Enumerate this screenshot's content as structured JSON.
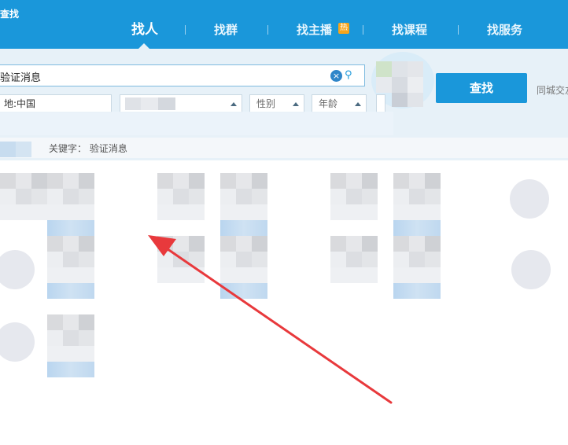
{
  "window": {
    "title": "查找"
  },
  "nav": {
    "tabs": [
      {
        "label": "找人"
      },
      {
        "label": "找群"
      },
      {
        "label": "找主播"
      },
      {
        "label": "找课程"
      },
      {
        "label": "找服务"
      }
    ],
    "hot_badge": "热"
  },
  "search": {
    "value": "验证消息",
    "clear_icon": "clear-icon",
    "location_icon": "location-pin-icon"
  },
  "filters": {
    "location": "地:中国",
    "gender": "性别",
    "age": "年龄"
  },
  "actions": {
    "find_label": "查找",
    "side_link": "同城交友"
  },
  "results": {
    "keyword_label": "关键字：",
    "keyword": "验证消息"
  },
  "colors": {
    "header_blue": "#1a97da",
    "panel_bg": "#e7f1f8",
    "annotation_red": "#e8393c"
  }
}
